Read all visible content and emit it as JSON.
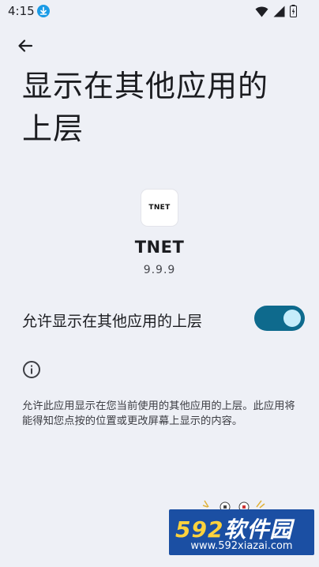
{
  "status_bar": {
    "time": "4:15"
  },
  "header": {
    "title": "显示在其他应用的上层"
  },
  "app": {
    "icon_text": "TNET",
    "name": "TNET",
    "version": "9.9.9"
  },
  "permission": {
    "label": "允许显示在其他应用的上层",
    "enabled": true
  },
  "info": {
    "description": "允许此应用显示在您当前使用的其他应用的上层。此应用将能得知您点按的位置或更改屏幕上显示的内容。"
  },
  "watermark": {
    "brand_num": "592",
    "brand_text": "软件园",
    "url": "www.592xiazai.com"
  },
  "colors": {
    "background": "#eef0f6",
    "toggle_track": "#0e6a8d",
    "toggle_knob": "#c5ecfb",
    "watermark_bg": "#1b4fa3"
  },
  "icons": [
    "download-icon",
    "wifi-icon",
    "signal-icon",
    "battery-icon",
    "back-arrow-icon",
    "info-icon"
  ]
}
